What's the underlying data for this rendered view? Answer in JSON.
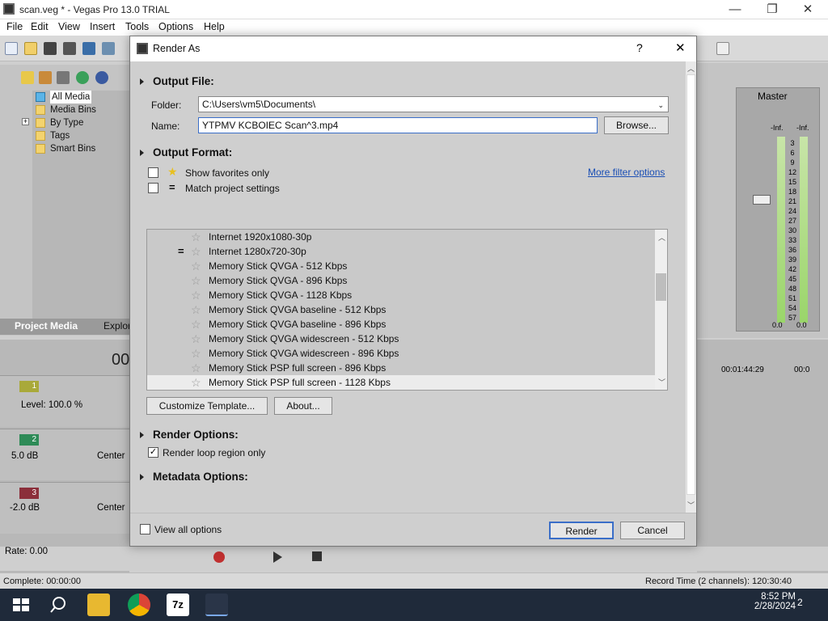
{
  "window": {
    "title": "scan.veg * - Vegas Pro 13.0 TRIAL",
    "minimize_glyph": "—",
    "maximize_glyph": "❐",
    "close_glyph": "✕"
  },
  "menu": [
    "File",
    "Edit",
    "View",
    "Insert",
    "Tools",
    "Options",
    "Help"
  ],
  "explorer": {
    "items": [
      "All Media",
      "Media Bins",
      "By Type",
      "Tags",
      "Smart Bins"
    ],
    "expand_glyph": "+",
    "tabs": [
      "Project Media",
      "Explor"
    ]
  },
  "timeline": {
    "time_partial": "00",
    "tracks": [
      {
        "number": "1",
        "level": "Level: 100.0 %",
        "color": "#a9a93a"
      },
      {
        "number": "2",
        "volume": "5.0 dB",
        "pan": "Center",
        "color": "#2e8b57"
      },
      {
        "number": "3",
        "volume": "-2.0 dB",
        "pan": "Center",
        "color": "#8b2e3a"
      }
    ],
    "ruler_time_1": "00:01:44:29",
    "ruler_time_2": "00:0"
  },
  "mixer": {
    "title": "Master",
    "peak_left": "-Inf.",
    "peak_right": "-Inf.",
    "scale": [
      "3",
      "6",
      "9",
      "12",
      "15",
      "18",
      "21",
      "24",
      "27",
      "30",
      "33",
      "36",
      "39",
      "42",
      "45",
      "48",
      "51",
      "54",
      "57"
    ],
    "readout_left": "0.0",
    "readout_right": "0.0"
  },
  "transport": {
    "rate": "Rate: 0.00"
  },
  "status": {
    "complete": "Complete: 00:00:00",
    "record_time": "Record Time (2 channels): 120:30:40"
  },
  "taskbar": {
    "time": "8:52 PM",
    "date": "2/28/2024",
    "notification_count": "2",
    "archiver_label": "7z"
  },
  "dialog": {
    "title": "Render As",
    "help_glyph": "?",
    "close_glyph": "✕",
    "output_file": {
      "heading": "Output File:",
      "folder_label": "Folder:",
      "folder_value": "C:\\Users\\vm5\\Documents\\",
      "name_label": "Name:",
      "name_value": "YTPMV KCBOIEC Scan^3.mp4",
      "browse_label": "Browse..."
    },
    "output_format": {
      "heading": "Output Format:",
      "show_favorites_label": "Show favorites only",
      "match_project_label": "Match project settings",
      "equals_glyph": "=",
      "more_filter_label": "More filter options",
      "templates": [
        "Internet 1920x1080-30p",
        "Internet 1280x720-30p",
        "Memory Stick QVGA - 512 Kbps",
        "Memory Stick QVGA - 896 Kbps",
        "Memory Stick QVGA - 1128 Kbps",
        "Memory Stick QVGA baseline - 512 Kbps",
        "Memory Stick QVGA baseline - 896 Kbps",
        "Memory Stick QVGA widescreen - 512 Kbps",
        "Memory Stick QVGA widescreen - 896 Kbps",
        "Memory Stick PSP full screen - 896 Kbps",
        "Memory Stick PSP full screen - 1128 Kbps"
      ],
      "selected_index": 10,
      "matched_index": 1,
      "customize_label": "Customize Template...",
      "about_label": "About..."
    },
    "render_options": {
      "heading": "Render Options:",
      "loop_region_label": "Render loop region only",
      "loop_region_checked": true
    },
    "metadata_options": {
      "heading": "Metadata Options:"
    },
    "footer": {
      "view_all_label": "View all options",
      "render_label": "Render",
      "cancel_label": "Cancel"
    }
  }
}
